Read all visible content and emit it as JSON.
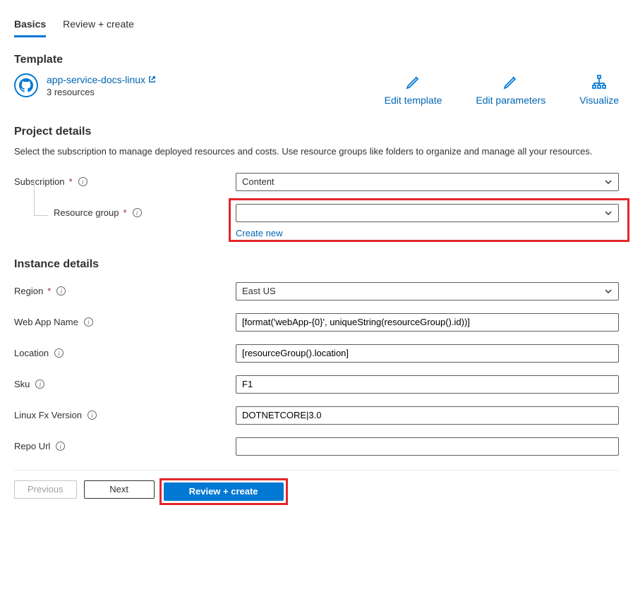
{
  "tabs": {
    "basics": "Basics",
    "review": "Review + create"
  },
  "template": {
    "heading": "Template",
    "link_text": "app-service-docs-linux",
    "resource_count": "3 resources",
    "actions": {
      "edit_template": "Edit template",
      "edit_parameters": "Edit parameters",
      "visualize": "Visualize"
    }
  },
  "project": {
    "heading": "Project details",
    "description": "Select the subscription to manage deployed resources and costs. Use resource groups like folders to organize and manage all your resources.",
    "subscription_label": "Subscription",
    "subscription_value": "Content",
    "resource_group_label": "Resource group",
    "resource_group_value": "",
    "create_new": "Create new"
  },
  "instance": {
    "heading": "Instance details",
    "region_label": "Region",
    "region_value": "East US",
    "webapp_label": "Web App Name",
    "webapp_value": "[format('webApp-{0}', uniqueString(resourceGroup().id))]",
    "location_label": "Location",
    "location_value": "[resourceGroup().location]",
    "sku_label": "Sku",
    "sku_value": "F1",
    "linuxfx_label": "Linux Fx Version",
    "linuxfx_value": "DOTNETCORE|3.0",
    "repourl_label": "Repo Url",
    "repourl_value": ""
  },
  "footer": {
    "previous": "Previous",
    "next": "Next",
    "review_create": "Review + create"
  }
}
